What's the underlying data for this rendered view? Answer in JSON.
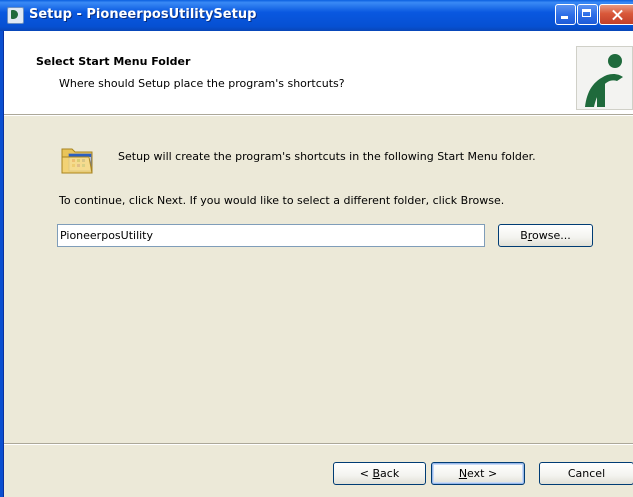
{
  "window": {
    "title": "Setup - PioneerposUtilitySetup"
  },
  "header": {
    "title": "Select Start Menu Folder",
    "subtitle": "Where should Setup place the program's shortcuts?"
  },
  "body": {
    "info_text": "Setup will create the program's shortcuts in the following Start Menu folder.",
    "continue_text": "To continue, click Next. If you would like to select a different folder, click Browse.",
    "folder_value": "PioneerposUtility"
  },
  "buttons": {
    "browse_before": "B",
    "browse_accel": "r",
    "browse_after": "owse...",
    "back_prefix": "< ",
    "back_accel": "B",
    "back_rest": "ack",
    "next_accel": "N",
    "next_rest": "ext >",
    "cancel": "Cancel"
  },
  "icons": {
    "app": "app-icon",
    "folder": "start-menu-folder-icon",
    "logo": "pioneer-logo"
  },
  "colors": {
    "titlebar": "#0a5fe0",
    "dialog_bg": "#ece9d8",
    "selection": "#316ac5",
    "logo_green": "#1f6a3c"
  }
}
